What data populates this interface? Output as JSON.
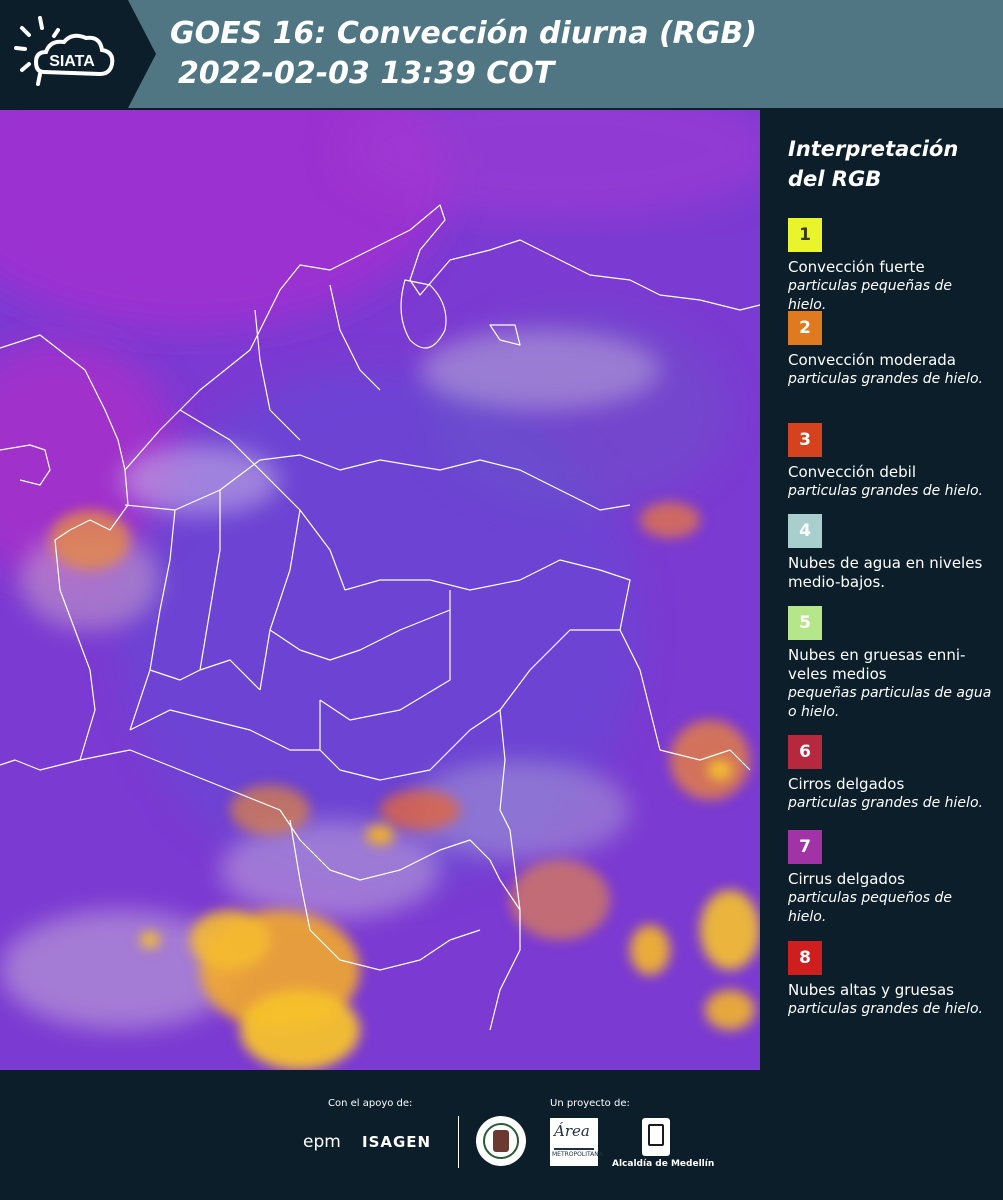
{
  "header": {
    "logo_text": "SIATA",
    "title_line1": "GOES 16: Convección diurna (RGB)",
    "title_line2": "2022-02-03 13:39 COT"
  },
  "legend": {
    "title": "Interpretación del RGB",
    "items": [
      {
        "number": "1",
        "color": "#e9f42a",
        "label": "Convección fuerte",
        "sub": "particulas pequeñas de hielo."
      },
      {
        "number": "2",
        "color": "#e07a1f",
        "label": "Convección moderada",
        "sub": "particulas grandes de hielo."
      },
      {
        "number": "3",
        "color": "#d6421e",
        "label": "Convección debil",
        "sub": "particulas grandes de hielo."
      },
      {
        "number": "4",
        "color": "#a8cfcd",
        "label": "Nubes de agua en niveles medio-bajos.",
        "sub": ""
      },
      {
        "number": "5",
        "color": "#b6e68a",
        "label": "Nubes en gruesas enni-veles medios",
        "sub": "pequeñas particulas de agua o hielo."
      },
      {
        "number": "6",
        "color": "#b5283e",
        "label": "Cirros delgados",
        "sub": "particulas grandes de hielo."
      },
      {
        "number": "7",
        "color": "#a233a6",
        "label": "Cirrus delgados",
        "sub": "particulas pequeños de hielo."
      },
      {
        "number": "8",
        "color": "#cf1e1e",
        "label": "Nubes altas y gruesas",
        "sub": "particulas grandes de hielo."
      }
    ]
  },
  "footer": {
    "support_caption": "Con el apoyo de:",
    "project_caption": "Un proyecto de:",
    "sponsor1": "epm",
    "sponsor2": "ISAGEN",
    "area_name": "Área",
    "area_sub": "METROPOLITANA",
    "alcaldia": "Alcaldía de Medellín"
  },
  "colors": {
    "header_bg": "#4f7682",
    "panel_bg": "#0c1e2a",
    "map_base": "#7a3ad4"
  }
}
